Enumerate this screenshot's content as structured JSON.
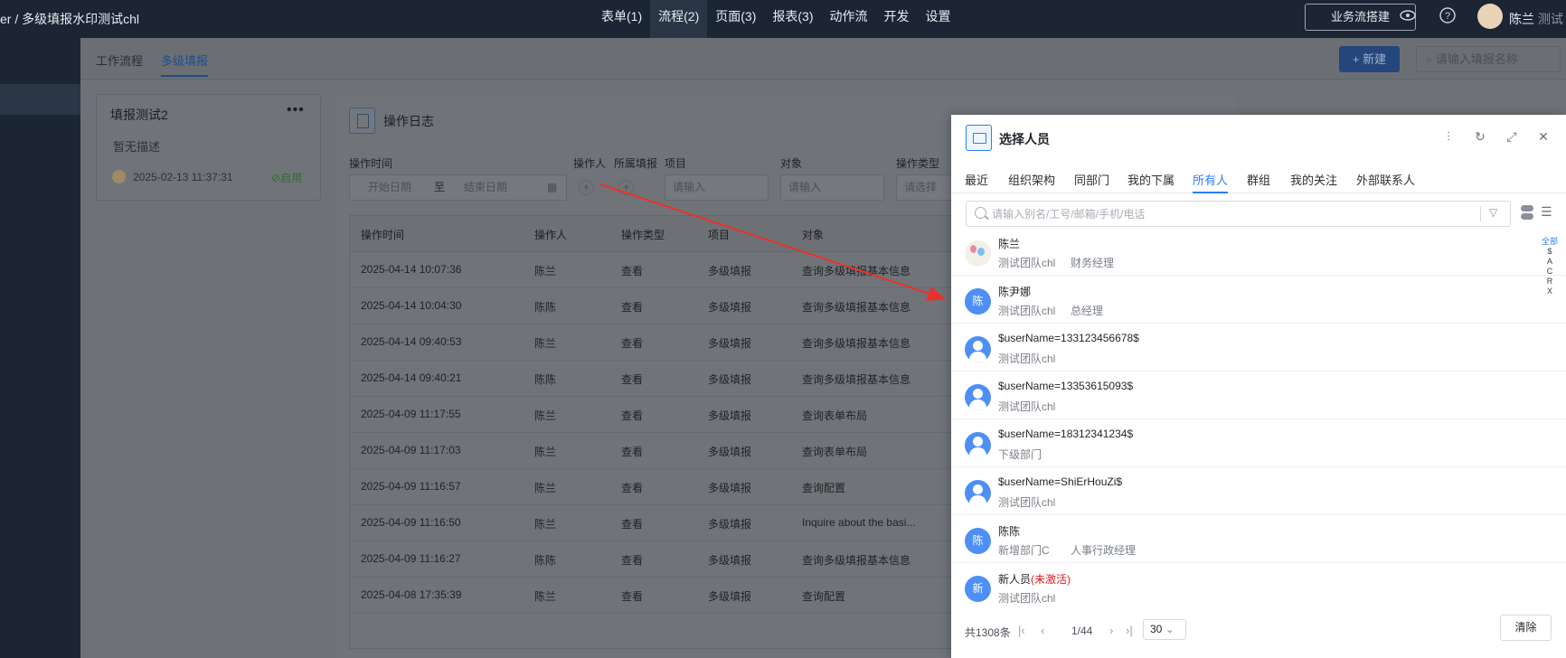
{
  "topbar": {
    "breadcrumb": "er / 多级填报水印测试chl",
    "nav": [
      "表单(1)",
      "流程(2)",
      "页面(3)",
      "报表(3)",
      "动作流",
      "开发",
      "设置"
    ],
    "flow_button": "业务流搭建",
    "user_name": "陈兰",
    "user_suffix": "测试"
  },
  "page_tabs": [
    "工作流程",
    "多级填报"
  ],
  "new_button": "+ 新建",
  "search_placeholder": "请输入填报名称",
  "card": {
    "title": "填报测试2",
    "description": "暂无描述",
    "date": "2025-02-13 11:37:31",
    "status": "启用"
  },
  "log_panel": {
    "title": "操作日志",
    "filters": {
      "time_label": "操作时间",
      "start_placeholder": "开始日期",
      "to": "至",
      "end_placeholder": "结束日期",
      "operator_label": "操作人",
      "filled_label": "所属填报",
      "project_label": "项目",
      "project_placeholder": "请输入",
      "object_label": "对象",
      "object_placeholder": "请输入",
      "type_label": "操作类型",
      "type_placeholder": "请选择"
    },
    "columns": [
      "操作时间",
      "操作人",
      "操作类型",
      "项目",
      "对象"
    ],
    "rows": [
      [
        "2025-04-14 10:07:36",
        "陈兰",
        "查看",
        "多级填报",
        "查询多级填报基本信息"
      ],
      [
        "2025-04-14 10:04:30",
        "陈陈",
        "查看",
        "多级填报",
        "查询多级填报基本信息"
      ],
      [
        "2025-04-14 09:40:53",
        "陈兰",
        "查看",
        "多级填报",
        "查询多级填报基本信息"
      ],
      [
        "2025-04-14 09:40:21",
        "陈陈",
        "查看",
        "多级填报",
        "查询多级填报基本信息"
      ],
      [
        "2025-04-09 11:17:55",
        "陈兰",
        "查看",
        "多级填报",
        "查询表单布局"
      ],
      [
        "2025-04-09 11:17:03",
        "陈兰",
        "查看",
        "多级填报",
        "查询表单布局"
      ],
      [
        "2025-04-09 11:16:57",
        "陈兰",
        "查看",
        "多级填报",
        "查询配置"
      ],
      [
        "2025-04-09 11:16:50",
        "陈兰",
        "查看",
        "多级填报",
        "Inquire about the basi..."
      ],
      [
        "2025-04-09 11:16:27",
        "陈陈",
        "查看",
        "多级填报",
        "查询多级填报基本信息"
      ],
      [
        "2025-04-08 17:35:39",
        "陈兰",
        "查看",
        "多级填报",
        "查询配置"
      ]
    ]
  },
  "dialog": {
    "title": "选择人员",
    "tabs": [
      "最近",
      "组织架构",
      "同部门",
      "我的下属",
      "所有人",
      "群组",
      "我的关注",
      "外部联系人"
    ],
    "active_tab": "所有人",
    "search_placeholder": "请输入别名/工号/邮箱/手机/电话",
    "people": [
      {
        "name": "陈兰",
        "dept": "测试团队chl",
        "title": "财务经理",
        "avatar": "photo",
        "initial": ""
      },
      {
        "name": "陈尹娜",
        "dept": "测试团队chl",
        "title": "总经理",
        "avatar": "initial",
        "initial": "陈"
      },
      {
        "name": "$userName=133123456678$",
        "dept": "测试团队chl",
        "title": "",
        "avatar": "default",
        "initial": ""
      },
      {
        "name": "$userName=13353615093$",
        "dept": "测试团队chl",
        "title": "",
        "avatar": "default",
        "initial": ""
      },
      {
        "name": "$userName=18312341234$",
        "dept": "下级部门",
        "title": "",
        "avatar": "default",
        "initial": ""
      },
      {
        "name": "$userName=ShiErHouZi$",
        "dept": "测试团队chl",
        "title": "",
        "avatar": "default",
        "initial": ""
      },
      {
        "name": "陈陈",
        "dept": "新增部门C",
        "title": "人事行政经理",
        "avatar": "initial",
        "initial": "陈"
      },
      {
        "name": "新人员",
        "inactive": "(未激活)",
        "dept": "测试团队chl",
        "title": "",
        "avatar": "initial",
        "initial": "新"
      }
    ],
    "alpha_index": [
      "全部",
      "$",
      "A",
      "C",
      "R",
      "X"
    ],
    "pager": {
      "total": "共1308条",
      "page": "1/44",
      "size": "30",
      "clear": "清除"
    }
  },
  "colors": {
    "accent": "#2d7df5",
    "arrow": "#e8322e",
    "inactive": "#e02020"
  }
}
